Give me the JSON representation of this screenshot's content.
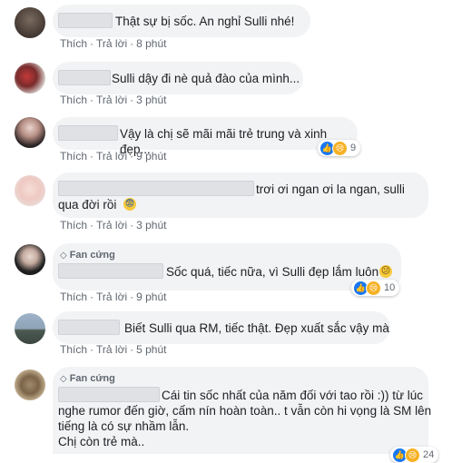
{
  "comments": [
    {
      "text": "Thật sự bị sốc. An nghỉ Sulli nhé!",
      "like": "Thích",
      "reply": "Trả lời",
      "time": "8 phút"
    },
    {
      "text": "Sulli dậy đi nè quả đào của mình...",
      "like": "Thích",
      "reply": "Trả lời",
      "time": "3 phút"
    },
    {
      "text": "Vậy là chị sẽ mãi mãi trẻ trung và xinh đẹp...",
      "like": "Thích",
      "reply": "Trả lời",
      "time": "9 phút",
      "reactions": "9"
    },
    {
      "text1": "trơi ơi ngan ơi la ngan, sulli",
      "text2": "qua đời rồi",
      "like": "Thích",
      "reply": "Trả lời",
      "time": "3 phút"
    },
    {
      "badge": "Fan cứng",
      "text": "Sốc quá, tiếc nữa, vì Sulli đẹp lắm luôn",
      "like": "Thích",
      "reply": "Trả lời",
      "time": "9 phút",
      "reactions": "10"
    },
    {
      "text": "Biết Sulli qua RM, tiếc thật. Đẹp xuất sắc vậy mà",
      "like": "Thích",
      "reply": "Trả lời",
      "time": "5 phút"
    },
    {
      "badge": "Fan cứng",
      "line1": "Cái tin sốc nhất của năm đối với tao rồi :)) từ lúc",
      "line2": "nghe rumor đến giờ, cấm nín hoàn toàn.. t vẫn còn hi vọng là SM lên",
      "line3": "tiếng là có sự nhầm lẫn.",
      "line4": "Chị còn trẻ mà..",
      "reactions": "24"
    }
  ],
  "colors": {
    "bubble": "#f2f3f5",
    "meta": "#606770",
    "like": "#1877f2",
    "sad": "#f7b125"
  }
}
